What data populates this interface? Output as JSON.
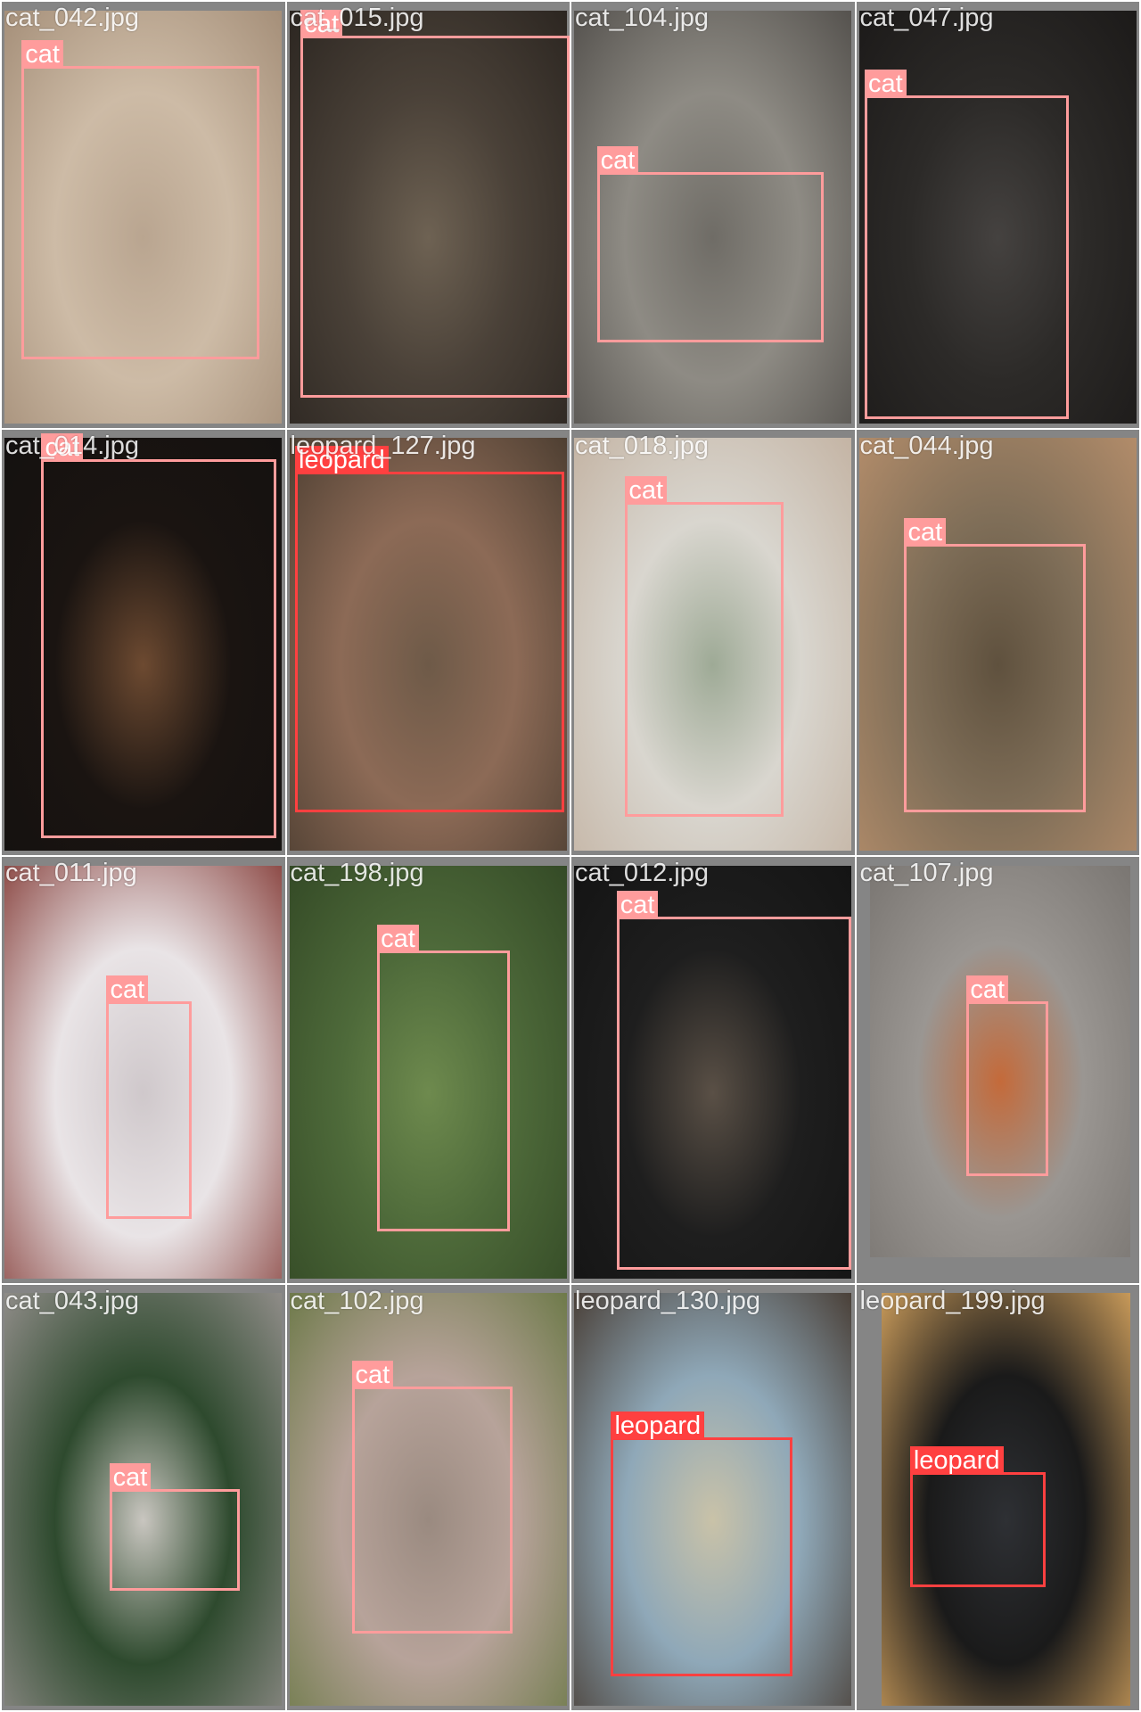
{
  "tiles": [
    {
      "file": "cat_042.jpg",
      "detections": [
        {
          "label": "cat"
        }
      ],
      "palette": [
        "#cdbba6",
        "#b9a590",
        "#a58f79"
      ]
    },
    {
      "file": "cat_015.jpg",
      "detections": [
        {
          "label": "cat"
        }
      ],
      "palette": [
        "#4a4138",
        "#6e6253",
        "#2c2621"
      ]
    },
    {
      "file": "cat_104.jpg",
      "detections": [
        {
          "label": "cat"
        }
      ],
      "palette": [
        "#8e8b84",
        "#6f6c66",
        "#55524e"
      ]
    },
    {
      "file": "cat_047.jpg",
      "detections": [
        {
          "label": "cat"
        }
      ],
      "palette": [
        "#2c2a28",
        "#454240",
        "#1c1a19"
      ]
    },
    {
      "file": "cat_014.jpg",
      "detections": [
        {
          "label": "cat"
        }
      ],
      "palette": [
        "#1a1411",
        "#6d4a31",
        "#141110"
      ]
    },
    {
      "file": "leopard_127.jpg",
      "detections": [
        {
          "label": "leopard"
        }
      ],
      "palette": [
        "#8c6a56",
        "#6e5a48",
        "#4e3f32"
      ]
    },
    {
      "file": "cat_018.jpg",
      "detections": [
        {
          "label": "cat"
        }
      ],
      "palette": [
        "#d9d6cf",
        "#9eaa96",
        "#c4b4a4"
      ]
    },
    {
      "file": "cat_044.jpg",
      "detections": [
        {
          "label": "cat"
        }
      ],
      "palette": [
        "#7f6e58",
        "#5f513e",
        "#b28c6a"
      ]
    },
    {
      "file": "cat_011.jpg",
      "detections": [
        {
          "label": "cat"
        }
      ],
      "palette": [
        "#e9e4e6",
        "#cfc8cb",
        "#8e4c48"
      ]
    },
    {
      "file": "cat_198.jpg",
      "detections": [
        {
          "label": "cat"
        }
      ],
      "palette": [
        "#4e6a3a",
        "#6e8a4e",
        "#344a26"
      ]
    },
    {
      "file": "cat_012.jpg",
      "detections": [
        {
          "label": "cat"
        }
      ],
      "palette": [
        "#1e1e1e",
        "#5a5046",
        "#141414"
      ]
    },
    {
      "file": "cat_107.jpg",
      "detections": [
        {
          "label": "cat"
        }
      ],
      "palette": [
        "#9a9692",
        "#c46a3a",
        "#7a7672"
      ]
    },
    {
      "file": "cat_043.jpg",
      "detections": [
        {
          "label": "cat"
        }
      ],
      "palette": [
        "#2e4a2e",
        "#c9c6c0",
        "#8f8c88"
      ]
    },
    {
      "file": "cat_102.jpg",
      "detections": [
        {
          "label": "cat"
        }
      ],
      "palette": [
        "#b7a39a",
        "#9a8a80",
        "#6e7a4a"
      ]
    },
    {
      "file": "leopard_130.jpg",
      "detections": [
        {
          "label": "leopard"
        }
      ],
      "palette": [
        "#8fa8b8",
        "#c9c2a8",
        "#4a4038"
      ]
    },
    {
      "file": "leopard_199.jpg",
      "detections": [
        {
          "label": "leopard"
        }
      ],
      "palette": [
        "#1a1a1a",
        "#2e3034",
        "#c89a5a"
      ]
    }
  ]
}
